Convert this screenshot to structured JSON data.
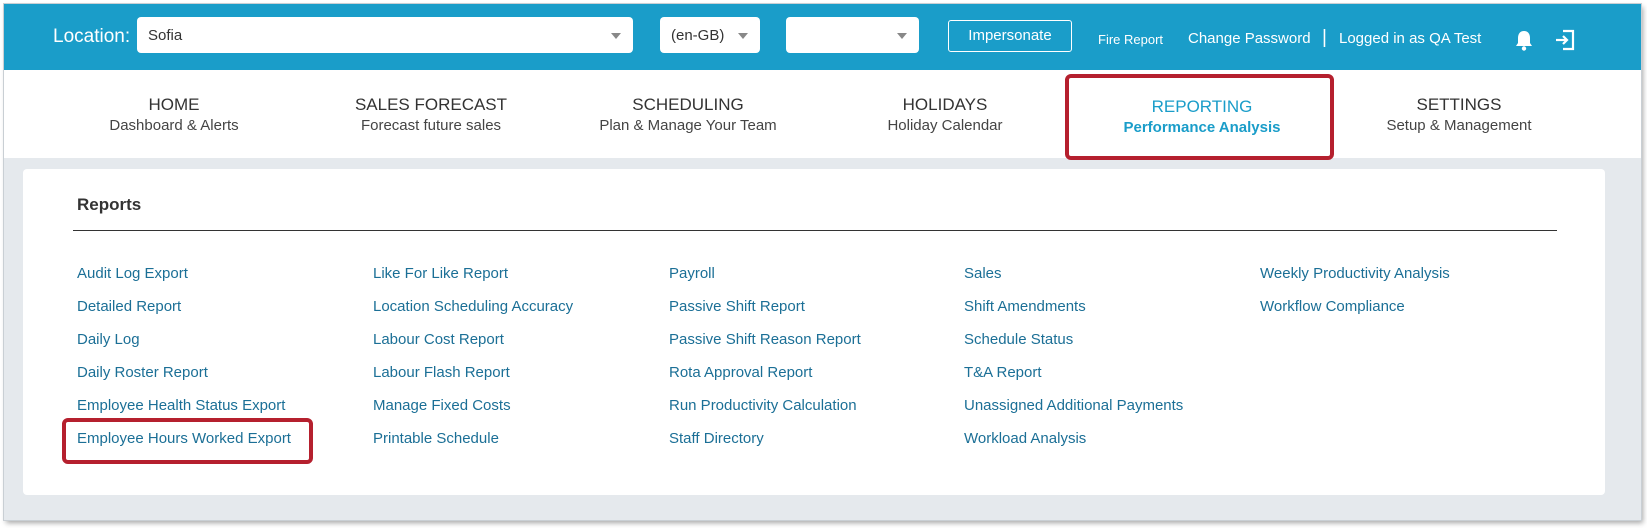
{
  "topbar": {
    "location_label": "Location:",
    "location_value": "Sofia",
    "language_value": "(en-GB)",
    "extra_value": "",
    "impersonate_label": "Impersonate",
    "fire_report": "Fire Report",
    "change_password": "Change Password",
    "separator": "|",
    "logged_in": "Logged in as QA Test",
    "icons": [
      "bell-icon",
      "logout-icon"
    ],
    "color": "#1a9dc9"
  },
  "nav": {
    "items": [
      {
        "title": "HOME",
        "sub": "Dashboard & Alerts"
      },
      {
        "title": "SALES FORECAST",
        "sub": "Forecast future sales"
      },
      {
        "title": "SCHEDULING",
        "sub": "Plan & Manage Your Team"
      },
      {
        "title": "HOLIDAYS",
        "sub": "Holiday Calendar"
      },
      {
        "title": "REPORTING",
        "sub": "Performance Analysis",
        "active": true
      },
      {
        "title": "SETTINGS",
        "sub": "Setup & Management"
      }
    ],
    "active_color": "#1a9dc9",
    "highlight_color": "#b5202e"
  },
  "reports": {
    "title": "Reports",
    "link_color": "#1b6f96",
    "columns": [
      [
        "Audit Log Export",
        "Detailed Report",
        "Daily Log",
        "Daily Roster Report",
        "Employee Health Status Export",
        "Employee Hours Worked Export"
      ],
      [
        "Like For Like Report",
        "Location Scheduling Accuracy",
        "Labour Cost Report",
        "Labour Flash Report",
        "Manage Fixed Costs",
        "Printable Schedule"
      ],
      [
        "Payroll",
        "Passive Shift Report",
        "Passive Shift Reason Report",
        "Rota Approval Report",
        "Run Productivity Calculation",
        "Staff Directory"
      ],
      [
        "Sales",
        "Shift Amendments",
        "Schedule Status",
        "T&A Report",
        "Unassigned Additional Payments",
        "Workload Analysis"
      ],
      [
        "Weekly Productivity Analysis",
        "Workflow Compliance"
      ]
    ]
  }
}
